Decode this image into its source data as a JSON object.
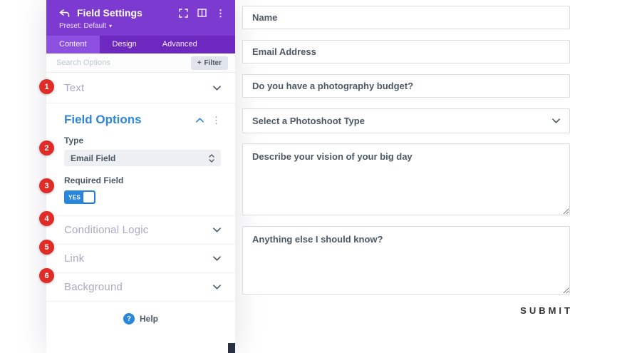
{
  "panel": {
    "title": "Field Settings",
    "preset_label": "Preset: Default",
    "tabs": [
      {
        "label": "Content"
      },
      {
        "label": "Design"
      },
      {
        "label": "Advanced"
      }
    ],
    "search_placeholder": "Search Options",
    "filter_label": "Filter",
    "sections": {
      "text": {
        "label": "Text",
        "badge": "1"
      },
      "field_options": {
        "label": "Field Options"
      },
      "conditional_logic": {
        "label": "Conditional Logic",
        "badge": "4"
      },
      "link": {
        "label": "Link",
        "badge": "5"
      },
      "background": {
        "label": "Background",
        "badge": "6"
      }
    },
    "field_options": {
      "type_label": "Type",
      "type_value": "Email Field",
      "type_badge": "2",
      "required_label": "Required Field",
      "required_badge": "3",
      "toggle_on": "YES"
    },
    "help_label": "Help"
  },
  "icons": {
    "plus": "+",
    "caret_down": "▾",
    "ellipsis": "⋮",
    "question": "?"
  },
  "form": {
    "name_placeholder": "Name",
    "email_placeholder": "Email Address",
    "budget_placeholder": "Do you have a photography budget?",
    "select_value": "Select a Photoshoot Type",
    "vision_placeholder": "Describe your vision of your big day",
    "notes_placeholder": "Anything else I should know?",
    "submit_label": "SUBMIT"
  },
  "colors": {
    "purple_header": "#7d3ad1",
    "purple_tabbar": "#6d28c0",
    "purple_tab_active": "#8d4fe0",
    "accent_blue": "#2b87da",
    "badge_red": "#e02b27",
    "text_dark": "#4c5866"
  }
}
